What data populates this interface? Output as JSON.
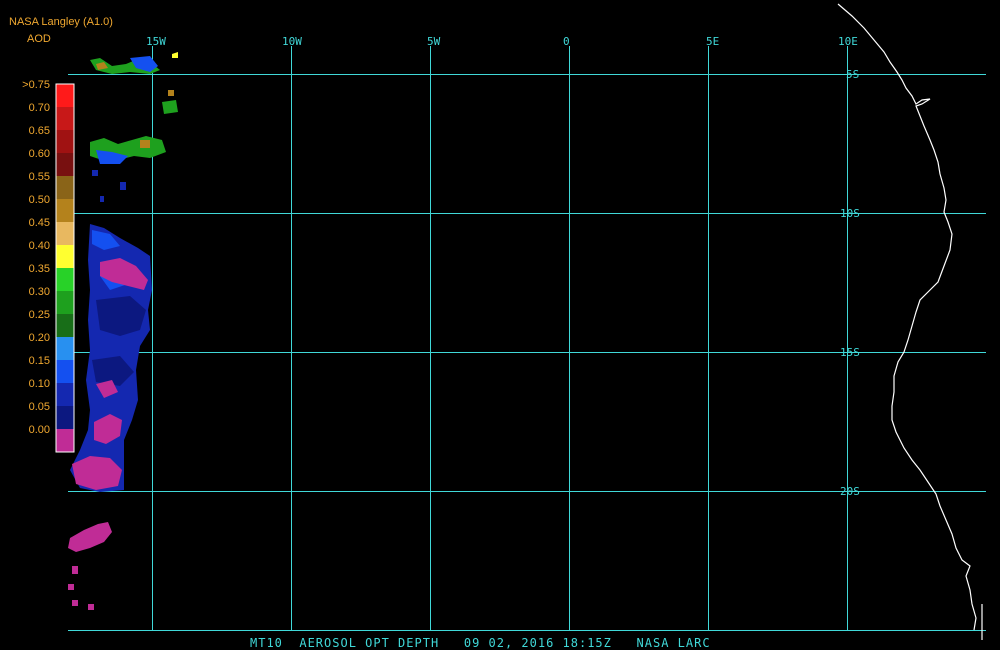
{
  "header": {
    "source": "NASA Langley (A1.0)",
    "product": "AOD"
  },
  "legend": {
    "labels": [
      ">0.75",
      "0.70",
      "0.65",
      "0.60",
      "0.55",
      "0.50",
      "0.45",
      "0.40",
      "0.35",
      "0.30",
      "0.25",
      "0.20",
      "0.15",
      "0.10",
      "0.05",
      "0.00"
    ],
    "colors": [
      "#ff1a1a",
      "#c81818",
      "#a01212",
      "#781010",
      "#8a6418",
      "#b4821c",
      "#e8b860",
      "#ffff30",
      "#28d228",
      "#1ea01e",
      "#186e18",
      "#2890f0",
      "#1450f0",
      "#1428b0",
      "#0c1880",
      "#c02c96"
    ]
  },
  "axes": {
    "longitude_labels": [
      "15W",
      "10W",
      "5W",
      "0",
      "5E",
      "10E"
    ],
    "latitude_labels": [
      "5S",
      "10S",
      "15S",
      "20S"
    ]
  },
  "caption": "MT10  AEROSOL OPT DEPTH   09 02, 2016 18:15Z   NASA LARC",
  "colors": {
    "grid": "#40d8d8",
    "coastline": "#ffffff",
    "label": "#f0a830"
  }
}
